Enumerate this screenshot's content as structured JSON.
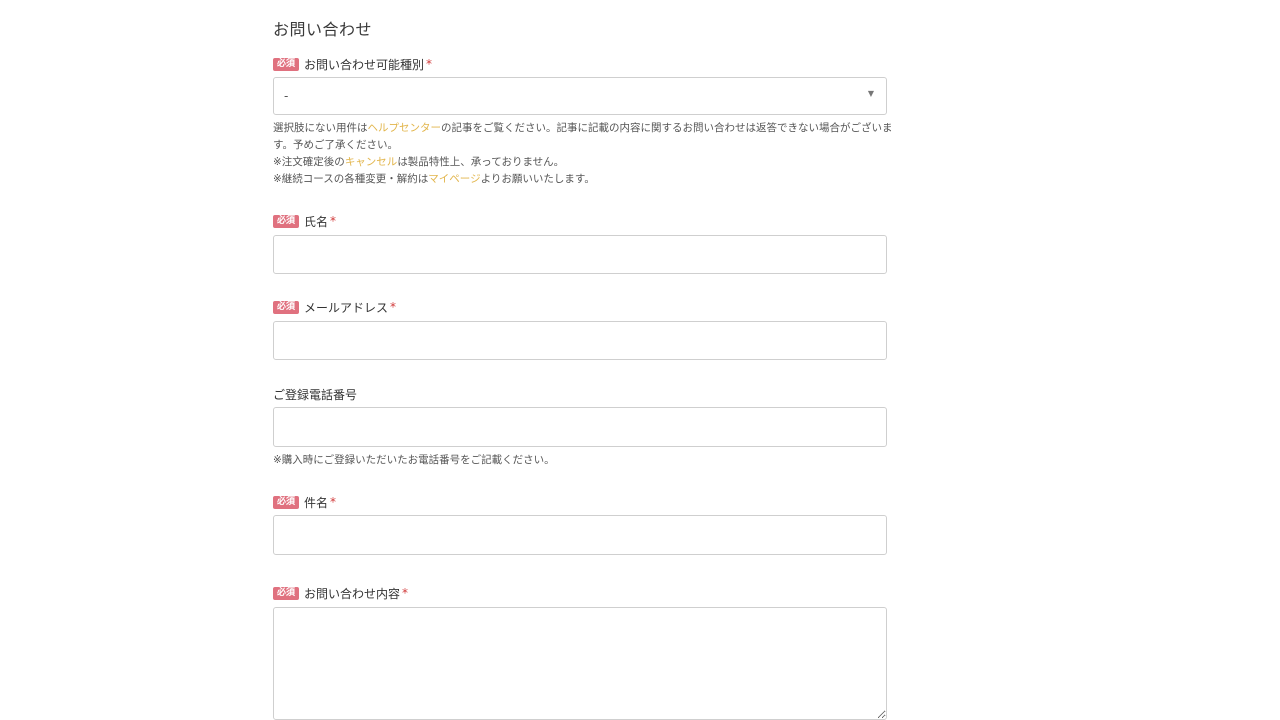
{
  "page": {
    "title": "お問い合わせ"
  },
  "required_badge": "必須",
  "required_mark": "*",
  "fields": {
    "inquiry_type": {
      "label": "お問い合わせ可能種別",
      "selected": "-",
      "help": {
        "line1_before": "選択肢にない用件は",
        "line1_link": "ヘルプセンター",
        "line1_after": "の記事をご覧ください。記事に記載の内容に関するお問い合わせは返答できない場合がございます。予めご了承ください。",
        "line2_before": "※注文確定後の",
        "line2_link": "キャンセル",
        "line2_after": "は製品特性上、承っておりません。",
        "line3_before": "※継続コースの各種変更・解約は",
        "line3_link": "マイページ",
        "line3_after": "よりお願いいたします。"
      }
    },
    "name": {
      "label": "氏名",
      "value": ""
    },
    "email": {
      "label": "メールアドレス",
      "value": ""
    },
    "phone": {
      "label": "ご登録電話番号",
      "value": "",
      "help": "※購入時にご登録いただいたお電話番号をご記載ください。"
    },
    "subject": {
      "label": "件名",
      "value": ""
    },
    "content": {
      "label": "お問い合わせ内容",
      "value": ""
    }
  },
  "colors": {
    "badge": "#e0717f",
    "link": "#e2b54b",
    "required": "#d23b3b",
    "border": "#cfcfcf"
  }
}
